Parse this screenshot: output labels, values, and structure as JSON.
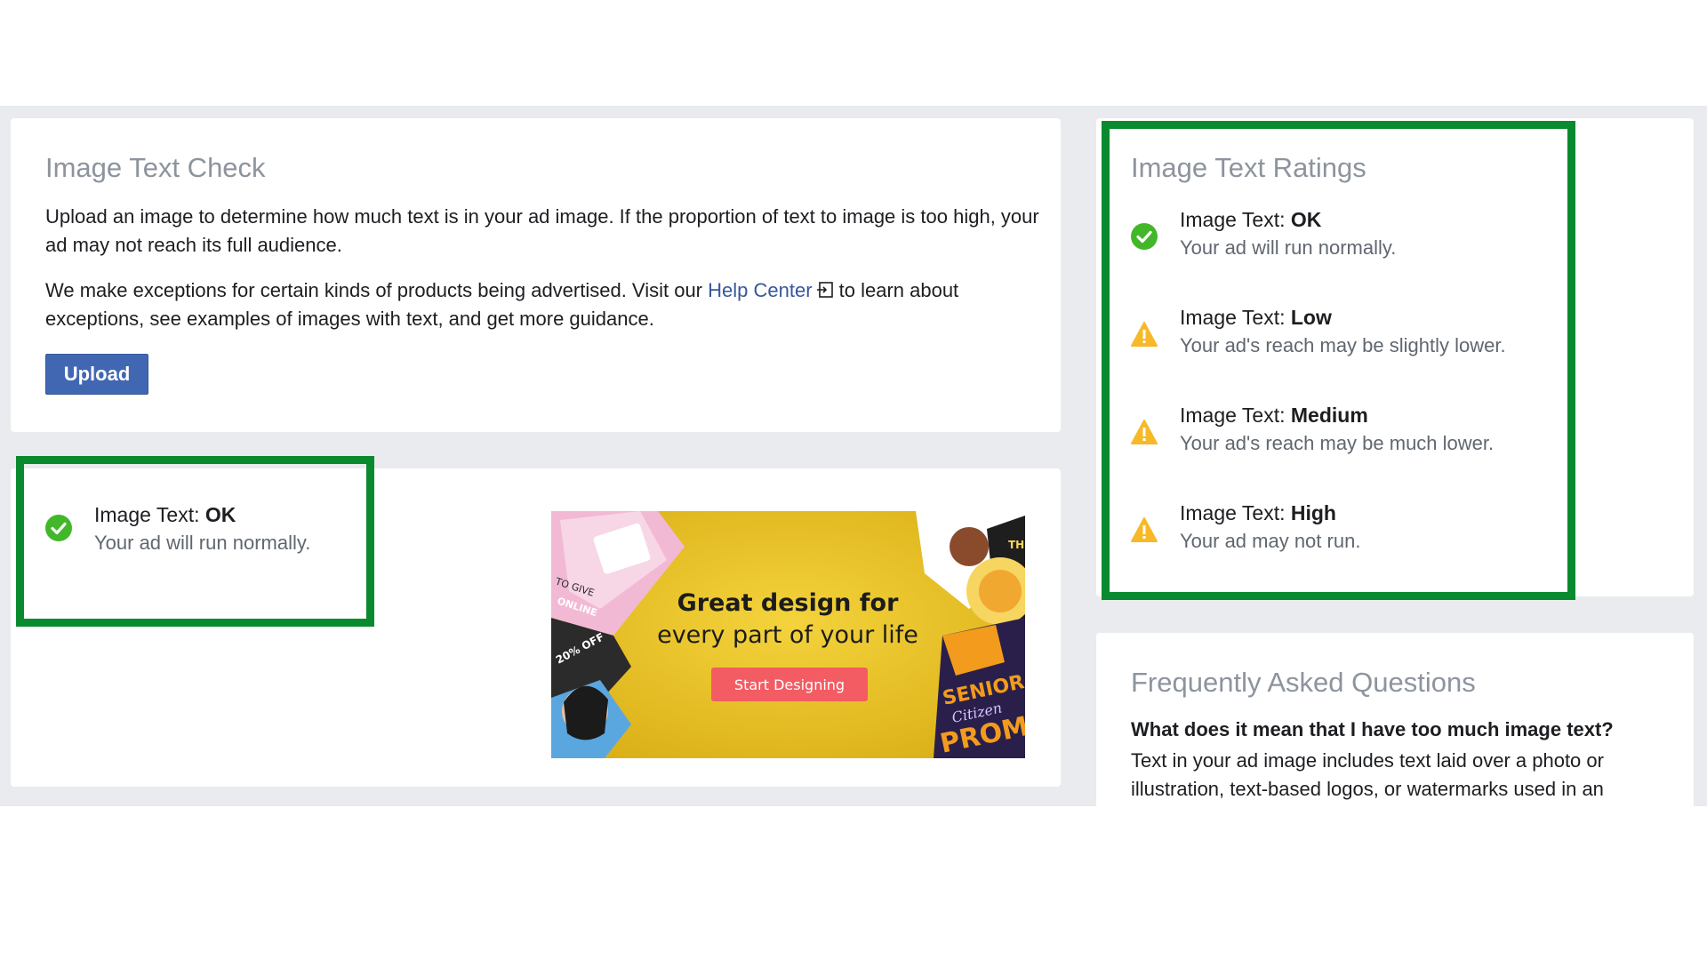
{
  "text_check": {
    "title": "Image Text Check",
    "para1": "Upload an image to determine how much text is in your ad image. If the proportion of text to image is too high, your ad may not reach its full audience.",
    "para2_before": "We make exceptions for certain kinds of products being advertised. Visit our ",
    "help_link": "Help Center",
    "para2_after": " to learn about exceptions, see examples of images with text, and get more guidance.",
    "upload_label": "Upload"
  },
  "result": {
    "label": "Image Text: ",
    "value": "OK",
    "message": "Your ad will run normally."
  },
  "ad_image": {
    "headline_line1": "Great design for",
    "headline_line2": "every part of your life",
    "cta": "Start Designing",
    "tag_give": "TO GIVE",
    "tag_online": "ONLINE",
    "tag_off": "20% OFF",
    "poster_prom": "PROM",
    "poster_senior": "SENIOR",
    "poster_script": "Citizen",
    "poster_the": "THE"
  },
  "ratings": {
    "title": "Image Text Ratings",
    "items": [
      {
        "label": "Image Text: ",
        "value": "OK",
        "message": "Your ad will run normally.",
        "icon": "check-circle-icon",
        "color": "#42b72a"
      },
      {
        "label": "Image Text: ",
        "value": "Low",
        "message": "Your ad's reach may be slightly lower.",
        "icon": "warning-icon",
        "color": "#f7b928"
      },
      {
        "label": "Image Text: ",
        "value": "Medium",
        "message": "Your ad's reach may be much lower.",
        "icon": "warning-icon",
        "color": "#f7b928"
      },
      {
        "label": "Image Text: ",
        "value": "High",
        "message": "Your ad may not run.",
        "icon": "warning-icon",
        "color": "#f7b928"
      }
    ]
  },
  "faq": {
    "title": "Frequently Asked Questions",
    "question": "What does it mean that I have too much image text?",
    "answer": "Text in your ad image includes text laid over a photo or illustration, text-based logos, or watermarks used in an"
  },
  "colors": {
    "highlight": "#0a8a2e",
    "primary_button": "#4267b2",
    "link": "#365899",
    "success": "#42b72a",
    "warning": "#f7b928"
  }
}
